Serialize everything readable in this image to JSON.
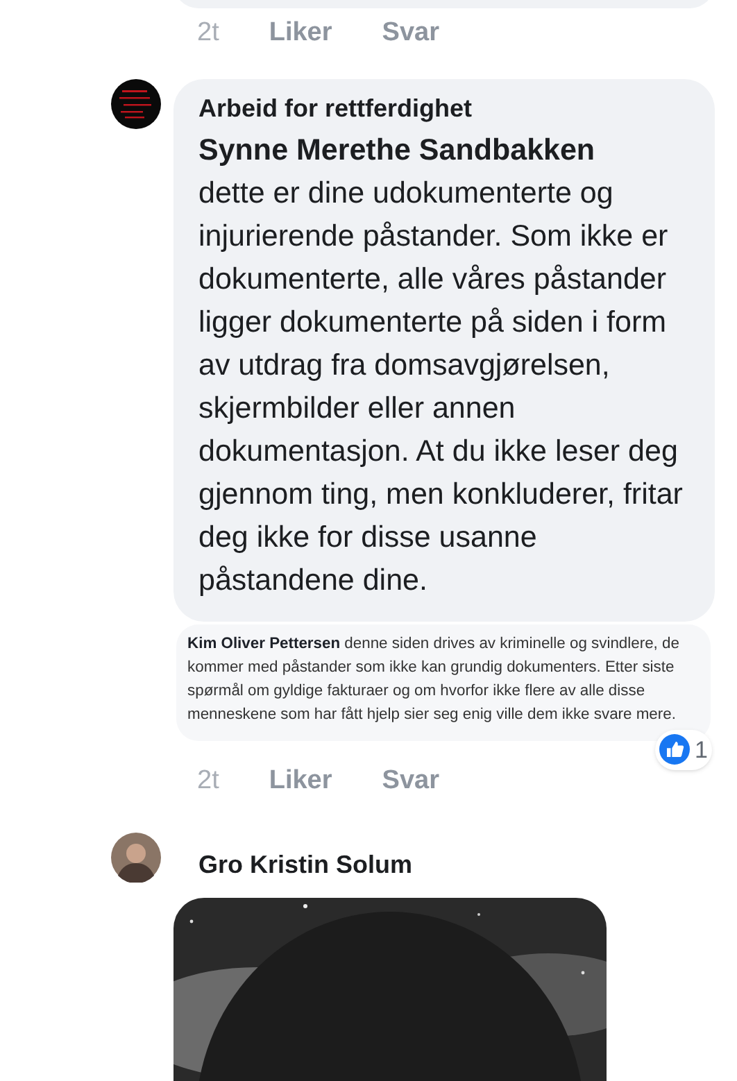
{
  "top_actions": {
    "time": "2t",
    "like": "Liker",
    "reply": "Svar"
  },
  "comment": {
    "author": "Arbeid for rettferdighet",
    "mention": "Synne Merethe Sandbakken",
    "text": "dette er dine udokumenterte og injurierende påstander. Som ikke er dokumenterte, alle våres påstander ligger dokumenterte på siden i form av utdrag fra domsavgjørelsen, skjermbilder eller annen dokumentasjon. At du ikke leser deg gjennom ting, men konkluderer, fritar deg ikke for disse usanne påstandene dine."
  },
  "screenshot": {
    "author": "Kim Oliver Pettersen",
    "text": "denne siden drives av kriminelle og svindlere, de kommer med påstander som ikke kan grundig dokumenters. Etter siste spørmål om gyldige fakturaer og om hvorfor ikke flere av alle disse menneskene som har fått hjelp sier seg enig ville dem ikke svare mere."
  },
  "reactions": {
    "count": "1"
  },
  "actions": {
    "time": "2t",
    "like": "Liker",
    "reply": "Svar"
  },
  "next_comment": {
    "author": "Gro Kristin Solum"
  }
}
